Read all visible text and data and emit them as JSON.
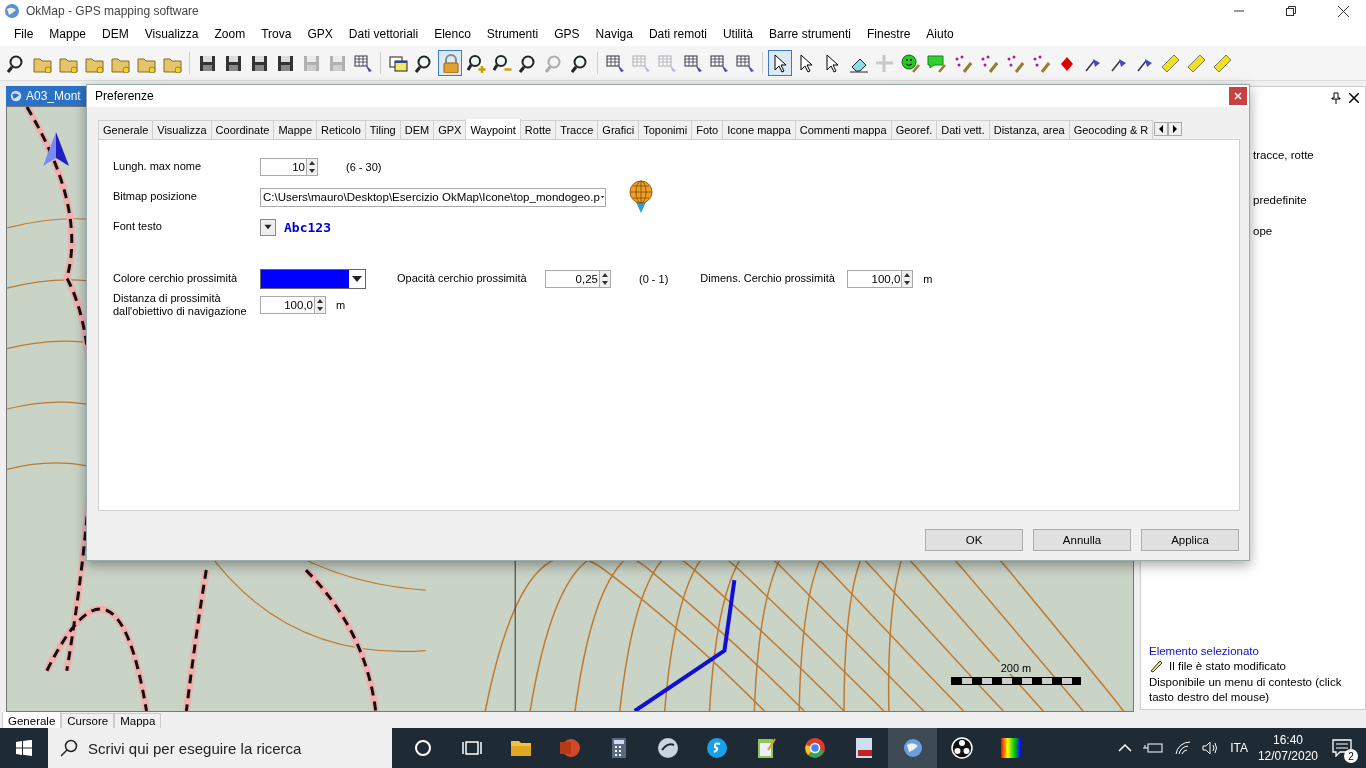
{
  "window": {
    "title": "OkMap - GPS mapping software"
  },
  "menu": [
    "File",
    "Mappe",
    "DEM",
    "Visualizza",
    "Zoom",
    "Trova",
    "GPX",
    "Dati vettoriali",
    "Elenco",
    "Strumenti",
    "GPS",
    "Naviga",
    "Dati remoti",
    "Utilità",
    "Barre strumenti",
    "Finestre",
    "Aiuto"
  ],
  "toolbar": [
    {
      "kind": "magnifier",
      "pressed": false,
      "disabled": false
    },
    {
      "kind": "folder",
      "pressed": false,
      "disabled": false
    },
    {
      "kind": "folder",
      "pressed": false,
      "disabled": false
    },
    {
      "kind": "folder",
      "pressed": false,
      "disabled": false
    },
    {
      "kind": "folder",
      "pressed": false,
      "disabled": false
    },
    {
      "kind": "folder",
      "pressed": false,
      "disabled": false
    },
    {
      "kind": "folder",
      "pressed": false,
      "disabled": false
    },
    {
      "kind": "separator"
    },
    {
      "kind": "floppy",
      "pressed": false,
      "disabled": false
    },
    {
      "kind": "floppy",
      "pressed": false,
      "disabled": false
    },
    {
      "kind": "floppy",
      "pressed": false,
      "disabled": false
    },
    {
      "kind": "floppy",
      "pressed": false,
      "disabled": false
    },
    {
      "kind": "floppy",
      "pressed": false,
      "disabled": true
    },
    {
      "kind": "floppy",
      "pressed": false,
      "disabled": true
    },
    {
      "kind": "table",
      "pressed": false,
      "disabled": false
    },
    {
      "kind": "separator"
    },
    {
      "kind": "window",
      "pressed": false,
      "disabled": false
    },
    {
      "kind": "magnifier",
      "pressed": false,
      "disabled": false
    },
    {
      "kind": "lock",
      "pressed": true,
      "disabled": false
    },
    {
      "kind": "zoom-in",
      "pressed": false,
      "disabled": false
    },
    {
      "kind": "zoom-out",
      "pressed": false,
      "disabled": false
    },
    {
      "kind": "magnifier",
      "pressed": false,
      "disabled": false
    },
    {
      "kind": "magnifier",
      "pressed": false,
      "disabled": true
    },
    {
      "kind": "magnifier",
      "pressed": false,
      "disabled": false
    },
    {
      "kind": "separator"
    },
    {
      "kind": "table",
      "pressed": false,
      "disabled": false
    },
    {
      "kind": "table",
      "pressed": false,
      "disabled": true
    },
    {
      "kind": "table",
      "pressed": false,
      "disabled": true
    },
    {
      "kind": "table",
      "pressed": false,
      "disabled": false
    },
    {
      "kind": "table",
      "pressed": false,
      "disabled": false
    },
    {
      "kind": "table",
      "pressed": false,
      "disabled": false
    },
    {
      "kind": "separator"
    },
    {
      "kind": "cursor",
      "pressed": true,
      "disabled": false
    },
    {
      "kind": "cursor",
      "pressed": false,
      "disabled": false
    },
    {
      "kind": "cursor",
      "pressed": false,
      "disabled": false
    },
    {
      "kind": "eraser",
      "pressed": false,
      "disabled": false
    },
    {
      "kind": "crosshair",
      "pressed": false,
      "disabled": true
    },
    {
      "kind": "smiley",
      "pressed": false,
      "disabled": false
    },
    {
      "kind": "comment",
      "pressed": false,
      "disabled": false
    },
    {
      "kind": "pencil",
      "pressed": false,
      "disabled": false
    },
    {
      "kind": "pencil",
      "pressed": false,
      "disabled": false
    },
    {
      "kind": "pencil",
      "pressed": false,
      "disabled": false
    },
    {
      "kind": "pencil",
      "pressed": false,
      "disabled": false
    },
    {
      "kind": "diamond",
      "pressed": false,
      "disabled": false
    },
    {
      "kind": "flag",
      "pressed": false,
      "disabled": false
    },
    {
      "kind": "flag",
      "pressed": false,
      "disabled": false
    },
    {
      "kind": "flag",
      "pressed": false,
      "disabled": false
    },
    {
      "kind": "ruler",
      "pressed": false,
      "disabled": false
    },
    {
      "kind": "ruler",
      "pressed": false,
      "disabled": false
    },
    {
      "kind": "ruler",
      "pressed": false,
      "disabled": false
    }
  ],
  "document_tab": {
    "label": "A03_Mont"
  },
  "map": {
    "scale_label": "200 m"
  },
  "side_panel": {
    "lines": [
      "tracce, rotte",
      "predefinite",
      "ope"
    ],
    "status_title": "Elemento selezionato",
    "status_lines": [
      "Il file è stato modificato",
      "Disponibile un menu di contesto (click tasto destro del mouse)"
    ]
  },
  "dialog": {
    "title": "Preferenze",
    "tabs": [
      {
        "label": "Generale",
        "selected": false
      },
      {
        "label": "Visualizza",
        "selected": false
      },
      {
        "label": "Coordinate",
        "selected": false
      },
      {
        "label": "Mappe",
        "selected": false
      },
      {
        "label": "Reticolo",
        "selected": false
      },
      {
        "label": "Tiling",
        "selected": false
      },
      {
        "label": "DEM",
        "selected": false
      },
      {
        "label": "GPX",
        "selected": false
      },
      {
        "label": "Waypoint",
        "selected": true
      },
      {
        "label": "Rotte",
        "selected": false
      },
      {
        "label": "Tracce",
        "selected": false
      },
      {
        "label": "Grafici",
        "selected": false
      },
      {
        "label": "Toponimi",
        "selected": false
      },
      {
        "label": "Foto",
        "selected": false
      },
      {
        "label": "Icone mappa",
        "selected": false
      },
      {
        "label": "Commenti mappa",
        "selected": false
      },
      {
        "label": "Georef.",
        "selected": false
      },
      {
        "label": "Dati vett.",
        "selected": false
      },
      {
        "label": "Distanza, area",
        "selected": false
      },
      {
        "label": "Geocoding & R",
        "selected": false
      }
    ],
    "rows": [
      {
        "fields": [
          {
            "kind": "spinner",
            "label": "Lungh. max nome",
            "value": "10",
            "hint": "(6 - 30)"
          }
        ]
      },
      {
        "fields": [
          {
            "kind": "path",
            "label": "Bitmap posizione",
            "value": "C:\\Users\\mauro\\Desktop\\Esercizio OkMap\\Icone\\top_mondogeo.p"
          }
        ]
      },
      {
        "fields": [
          {
            "kind": "font",
            "label": "Font testo",
            "sample": "Abc123",
            "color": "#0000cc"
          }
        ]
      },
      {
        "fields": [
          {
            "kind": "color",
            "label": "Colore cerchio prossimità",
            "color": "#0000ff"
          },
          {
            "kind": "spinner",
            "label": "Opacità cerchio prossimità",
            "value": "0,25",
            "hint": "(0 - 1)"
          },
          {
            "kind": "spinner",
            "label": "Dimens. Cerchio prossimità",
            "value": "100,0",
            "hint": "m"
          }
        ]
      },
      {
        "fields": [
          {
            "kind": "spinner",
            "label": "Distanza di prossimità\ndall'obiettivo di navigazione",
            "value": "100,0",
            "hint": "m"
          }
        ]
      }
    ],
    "buttons": [
      "OK",
      "Annulla",
      "Applica"
    ]
  },
  "bottom_tabs": [
    {
      "label": "Generale",
      "selected": true
    },
    {
      "label": "Cursore",
      "selected": false
    },
    {
      "label": "Mappa",
      "selected": false
    }
  ],
  "taskbar": {
    "search": {
      "placeholder": "Scrivi qui per eseguire la ricerca"
    },
    "apps": [
      {
        "kind": "cortana",
        "selected": false
      },
      {
        "kind": "taskview",
        "selected": false
      },
      {
        "kind": "folder",
        "selected": false
      },
      {
        "kind": "slides",
        "selected": false
      },
      {
        "kind": "calculator",
        "selected": false
      },
      {
        "kind": "steam",
        "selected": false
      },
      {
        "kind": "chat",
        "selected": false
      },
      {
        "kind": "notepad",
        "selected": false
      },
      {
        "kind": "browser",
        "selected": false
      },
      {
        "kind": "pdf",
        "selected": false
      },
      {
        "kind": "okmap",
        "selected": true
      },
      {
        "kind": "obs",
        "selected": false
      },
      {
        "kind": "palette",
        "selected": false
      }
    ],
    "language": "ITA",
    "time": "16:40",
    "date": "12/07/2020",
    "notifications": "2"
  }
}
